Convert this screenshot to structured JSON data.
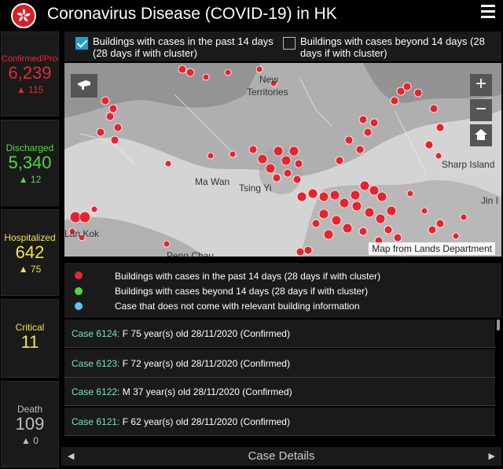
{
  "header": {
    "title": "Coronavirus Disease (COVID-19) in HK"
  },
  "stats": [
    {
      "label": "Confirmed/Prob",
      "value": "6,239",
      "change": "▲ 115",
      "color": "#e4283a"
    },
    {
      "label": "Discharged",
      "value": "5,340",
      "change": "▲ 12",
      "color": "#4cdd3a"
    },
    {
      "label": "Hospitalized",
      "value": "642",
      "change": "▲ 75",
      "color": "#f3e63a"
    },
    {
      "label": "Critical",
      "value": "11",
      "change": "",
      "color": "#f3e63a"
    },
    {
      "label": "Death",
      "value": "109",
      "change": "▲ 0",
      "color": "#bfbfbf"
    }
  ],
  "filters": {
    "past14": {
      "label_line1": "Buildings with cases in the past 14 days",
      "label_line2": "(28 days if with cluster)",
      "checked": true
    },
    "beyond14": {
      "label_line1": "Buildings with cases beyond 14 days (28",
      "label_line2": "days if with cluster)",
      "checked": false
    }
  },
  "map": {
    "attribution": "Map from Lands Department",
    "zoom_in": "+",
    "zoom_out": "−",
    "labels": {
      "new_territories_1": "New",
      "new_territories_2": "Territories",
      "ma_wan": "Ma Wan",
      "tsing_yi": "Tsing Yi",
      "sharp_island": "Sharp Island",
      "jin_island": "Jin I",
      "lantau_kok": "Lan Kok",
      "peng_chau": "Peng Chau"
    }
  },
  "legend": [
    {
      "text": "Buildings with cases in the past 14 days (28 days if with cluster)",
      "color": "#e4283a"
    },
    {
      "text": "Buildings with cases beyond 14 days (28 days if with cluster)",
      "color": "#4cdd3a"
    },
    {
      "text": "Case that does not come with relevant building information",
      "color": "#5ac8f0"
    }
  ],
  "cases": [
    {
      "id": "Case 6124:",
      "detail": "F  75 year(s) old  28/11/2020 (Confirmed)"
    },
    {
      "id": "Case 6123:",
      "detail": "F  72 year(s) old  28/11/2020 (Confirmed)"
    },
    {
      "id": "Case 6122:",
      "detail": "M  37 year(s) old  28/11/2020 (Confirmed)"
    },
    {
      "id": "Case 6121:",
      "detail": "F  62 year(s) old  28/11/2020 (Confirmed)"
    }
  ],
  "footer": {
    "label": "Case Details",
    "prev": "◀",
    "next": "▶"
  },
  "icons": {
    "logo": "bauhinia-icon",
    "menu": "hamburger-menu-icon",
    "home": "home-icon",
    "locate": "locate-icon"
  }
}
